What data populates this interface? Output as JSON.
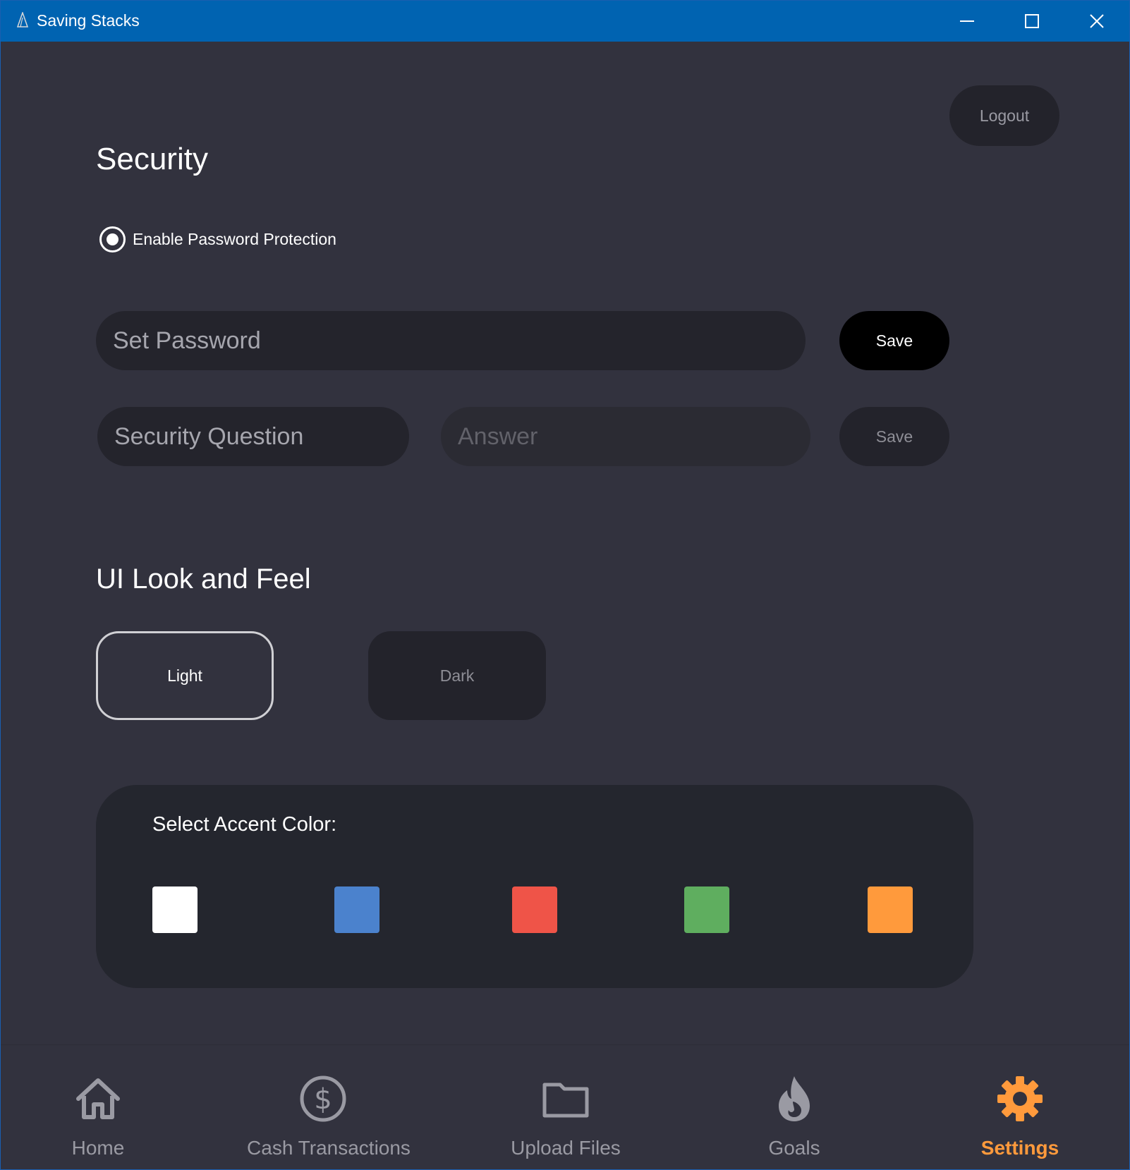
{
  "window": {
    "title": "Saving Stacks",
    "title_bar_color": "#0063b1"
  },
  "header": {
    "logout_label": "Logout"
  },
  "security": {
    "title": "Security",
    "password_protection_label": "Enable Password Protection",
    "password_protection_enabled": true,
    "password_placeholder": "Set Password",
    "password_save_label": "Save",
    "question_placeholder": "Security Question",
    "answer_placeholder": "Answer",
    "question_save_label": "Save"
  },
  "look_and_feel": {
    "title": "UI Look and Feel",
    "light_label": "Light",
    "dark_label": "Dark",
    "accent_label": "Select Accent Color:",
    "accent_colors": [
      {
        "name": "white",
        "hex": "#ffffff"
      },
      {
        "name": "blue",
        "hex": "#4b82cd"
      },
      {
        "name": "red",
        "hex": "#ef5448"
      },
      {
        "name": "green",
        "hex": "#5fae5f"
      },
      {
        "name": "orange",
        "hex": "#ff9a3c"
      }
    ]
  },
  "nav": {
    "items": [
      {
        "label": "Home",
        "icon": "home-icon",
        "active": false
      },
      {
        "label": "Cash Transactions",
        "icon": "dollar-circle-icon",
        "active": false
      },
      {
        "label": "Upload Files",
        "icon": "folder-icon",
        "active": false
      },
      {
        "label": "Goals",
        "icon": "flame-icon",
        "active": false
      },
      {
        "label": "Settings",
        "icon": "gear-icon",
        "active": true
      }
    ],
    "active_color": "#ff9a3c",
    "inactive_color": "#9a9aa3"
  }
}
